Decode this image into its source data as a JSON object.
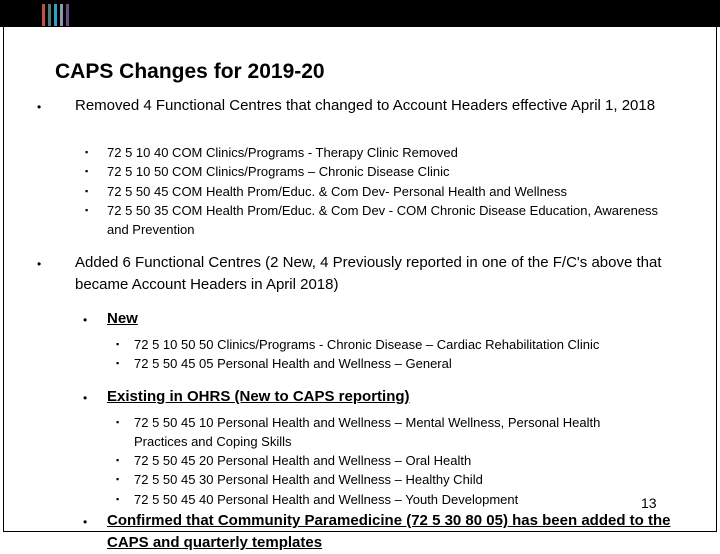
{
  "header": {
    "stripe_colors": [
      "#c0533b",
      "#4f7b80",
      "#2aa3c9",
      "#8a9aa6",
      "#6a4c86"
    ]
  },
  "slide": {
    "title": "CAPS Changes for 2019-20",
    "page_number": "13",
    "bullet_glyph": "•",
    "sub_bullet_glyph": "▪",
    "sections": [
      {
        "text": "Removed 4 Functional Centres that changed to Account Headers effective April 1, 2018",
        "items": [
          "72 5 10 40 COM Clinics/Programs - Therapy Clinic  Removed",
          "72 5 10 50 COM Clinics/Programs – Chronic Disease Clinic",
          "72 5 50 45 COM Health Prom/Educ. & Com Dev- Personal Health and Wellness",
          "72 5 50 35 COM Health Prom/Educ. & Com Dev - COM Chronic Disease Education, Awareness and Prevention"
        ]
      },
      {
        "text": "Added 6 Functional Centres (2 New, 4 Previously reported in one of the F/C's above that became Account Headers in April 2018)",
        "groups": [
          {
            "heading": "New",
            "items": [
              "72 5 10 50 50  Clinics/Programs - Chronic Disease – Cardiac Rehabilitation Clinic",
              "72 5 50 45 05 Personal Health and Wellness – General"
            ]
          },
          {
            "heading": "Existing in OHRS (New to CAPS reporting)",
            "items": [
              "72 5 50 45 10  Personal Health and Wellness – Mental Wellness, Personal Health Practices and Coping Skills",
              "72 5 50 45 20 Personal Health and Wellness – Oral Health",
              "72 5 50 45 30 Personal Health and Wellness –  Healthy Child",
              "72 5 50 45 40 Personal Health and Wellness – Youth Development"
            ]
          },
          {
            "heading": "Confirmed that Community Paramedicine (72 5 30 80 05) has been added to the CAPS and quarterly templates"
          }
        ]
      }
    ]
  }
}
